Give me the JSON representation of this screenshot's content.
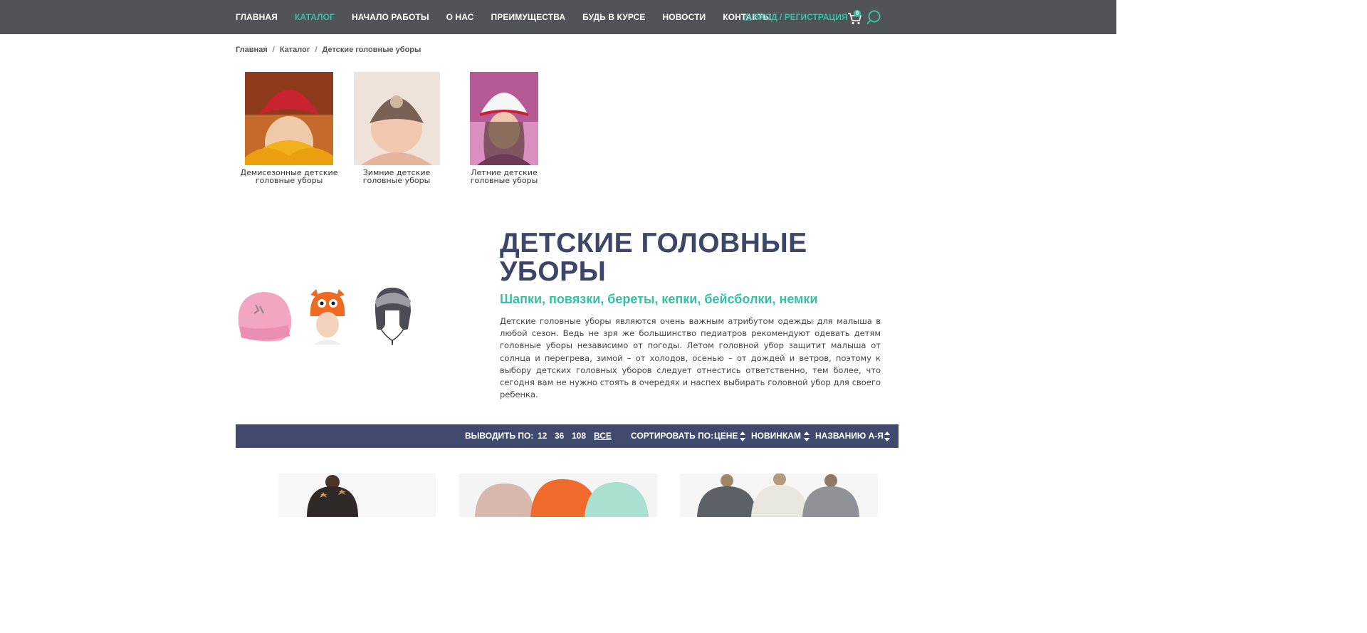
{
  "nav": {
    "items": [
      "Главная",
      "Каталог",
      "Начало работы",
      "О нас",
      "Преимущества",
      "Будь в курсе",
      "Новости",
      "Контакты"
    ],
    "active_index": 1,
    "login": "ВХОД / РЕГИСТРАЦИЯ",
    "cart_count": "0"
  },
  "breadcrumb": {
    "items": [
      "Главная",
      "Каталог"
    ],
    "current": "Детские головные уборы",
    "separator": "/"
  },
  "subcategories": [
    {
      "label_line1": "Демисезонные детские",
      "label_line2": "головные уборы"
    },
    {
      "label_line1": "Зимние детские",
      "label_line2": "головные уборы"
    },
    {
      "label_line1": "Летние детские",
      "label_line2": "головные уборы"
    }
  ],
  "hero": {
    "title": "Детские головные уборы",
    "subtitle": "Шапки, повязки, береты, кепки, бейсболки, немки",
    "description": "Детские головные уборы являются очень важным атрибутом одежды для малыша в любой сезон. Ведь не зря же большинство педиатров рекомендуют одевать детям головные уборы независимо от погоды. Летом головной убор защитит малыша от солнца и перегрева, зимой – от холодов, осенью – от дождей и ветров, поэтому к выбору детских головных уборов следует отнестись ответственно, тем более, что сегодня вам не нужно стоять в очередях и наспех выбирать головной убор для своего ребенка."
  },
  "toolbar": {
    "show_label": "ВЫВОДИТЬ ПО:",
    "show_options": [
      "12",
      "36",
      "108",
      "ВСЕ"
    ],
    "show_selected": "ВСЕ",
    "sort_label": "СОРТИРОВАТЬ ПО:",
    "sort_options": [
      "ЦЕНЕ",
      "НОВИНКАМ",
      "НАЗВАНИЮ А-Я"
    ]
  },
  "colors": {
    "topbar": "#505357",
    "accent": "#36c0a4",
    "heading": "#3d4669",
    "toolbar": "#414a6d"
  },
  "icons": [
    "lock-icon",
    "cart-icon",
    "search-icon",
    "sort-arrows-icon"
  ]
}
